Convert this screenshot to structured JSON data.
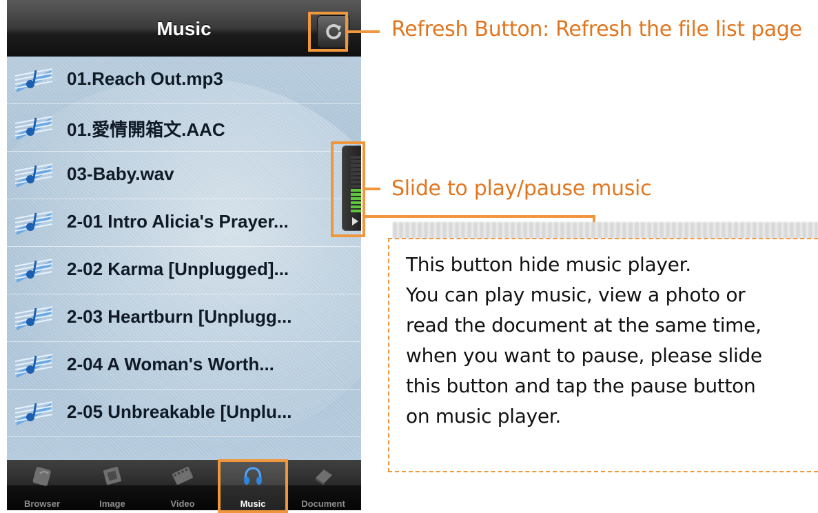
{
  "navbar": {
    "title": "Music"
  },
  "files": [
    "01.Reach Out.mp3",
    "01.愛情開箱文.AAC",
    "03-Baby.wav",
    "2-01 Intro Alicia's Prayer...",
    "2-02 Karma [Unplugged]...",
    "2-03 Heartburn [Unplugg...",
    "2-04 A Woman's Worth...",
    "2-05 Unbreakable [Unplu..."
  ],
  "tabs": [
    {
      "label": "Browser",
      "icon": "browser-icon"
    },
    {
      "label": "Image",
      "icon": "image-icon"
    },
    {
      "label": "Video",
      "icon": "video-icon"
    },
    {
      "label": "Music",
      "icon": "headphones-icon"
    },
    {
      "label": "Document",
      "icon": "document-icon"
    }
  ],
  "active_tab": "Music",
  "annotations": {
    "refresh": "Refresh Button: Refresh the file list page",
    "slide": "Slide to play/pause music",
    "note_lines": [
      "This button hide music player.",
      "You can play music, view a photo or",
      "read the document at the same time,",
      "when you want to pause, please slide",
      "this button and tap the pause button",
      "on music player."
    ]
  },
  "player_level": {
    "lit_bars": 6,
    "total_bars": 14
  },
  "colors": {
    "annotation": "#f0963c",
    "annotation_text": "#e2761f",
    "level_on": "#5ec63c"
  }
}
